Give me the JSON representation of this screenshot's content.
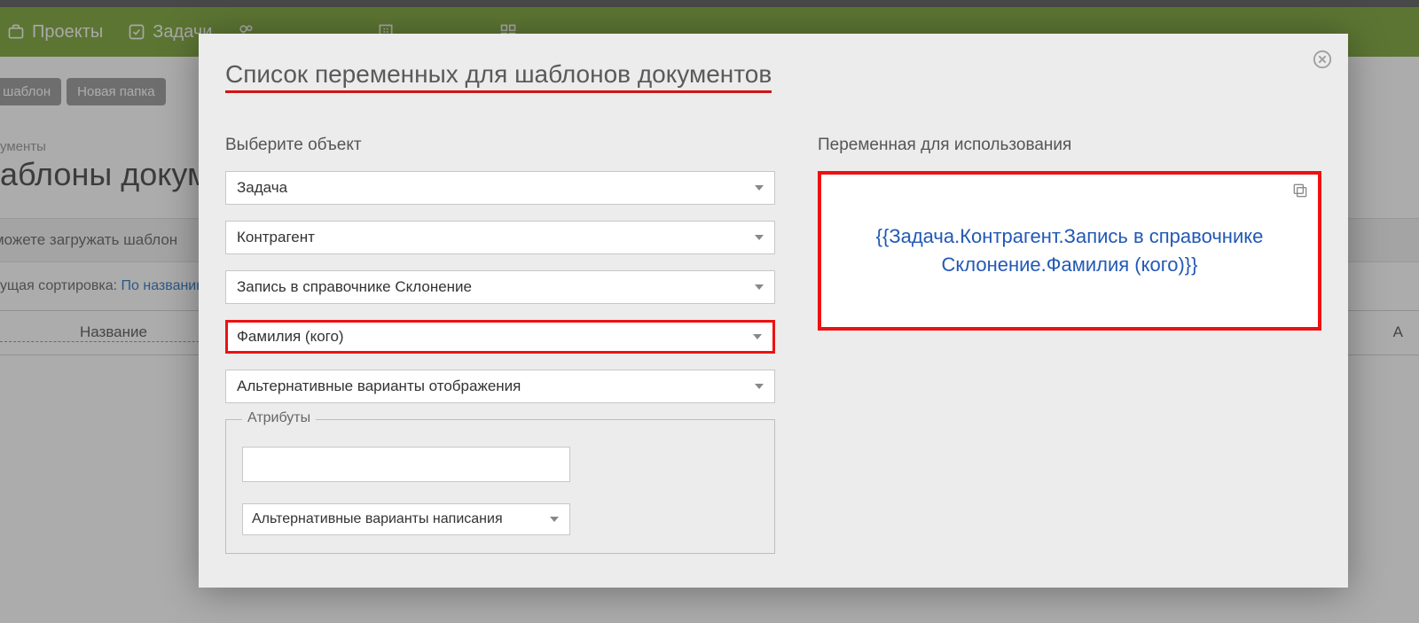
{
  "nav": {
    "projects": "Проекты",
    "tasks": "Задачи"
  },
  "toolbar": {
    "newTemplate": "вый шаблон",
    "newFolder": "Новая папка"
  },
  "bg": {
    "crumb": "ументы",
    "title": "аблоны докуме",
    "hint": "ы можете загружать шаблон",
    "sortLabel": "ущая сортировка:",
    "sortValue": "По названию",
    "col1": "Название",
    "col2": "А"
  },
  "modal": {
    "title": "Список переменных для шаблонов документов",
    "leftLabel": "Выберите объект",
    "rightLabel": "Переменная для использования",
    "selects": {
      "s1": "Задача",
      "s2": "Контрагент",
      "s3": "Запись в справочнике Склонение",
      "s4": "Фамилия (кого)",
      "s5": "Альтернативные варианты отображения"
    },
    "attrs": {
      "legend": "Атрибуты",
      "alt": "Альтернативные варианты написания"
    },
    "variable": "{{Задача.Контрагент.Запись в справочнике Склонение.Фамилия (кого)}}"
  }
}
